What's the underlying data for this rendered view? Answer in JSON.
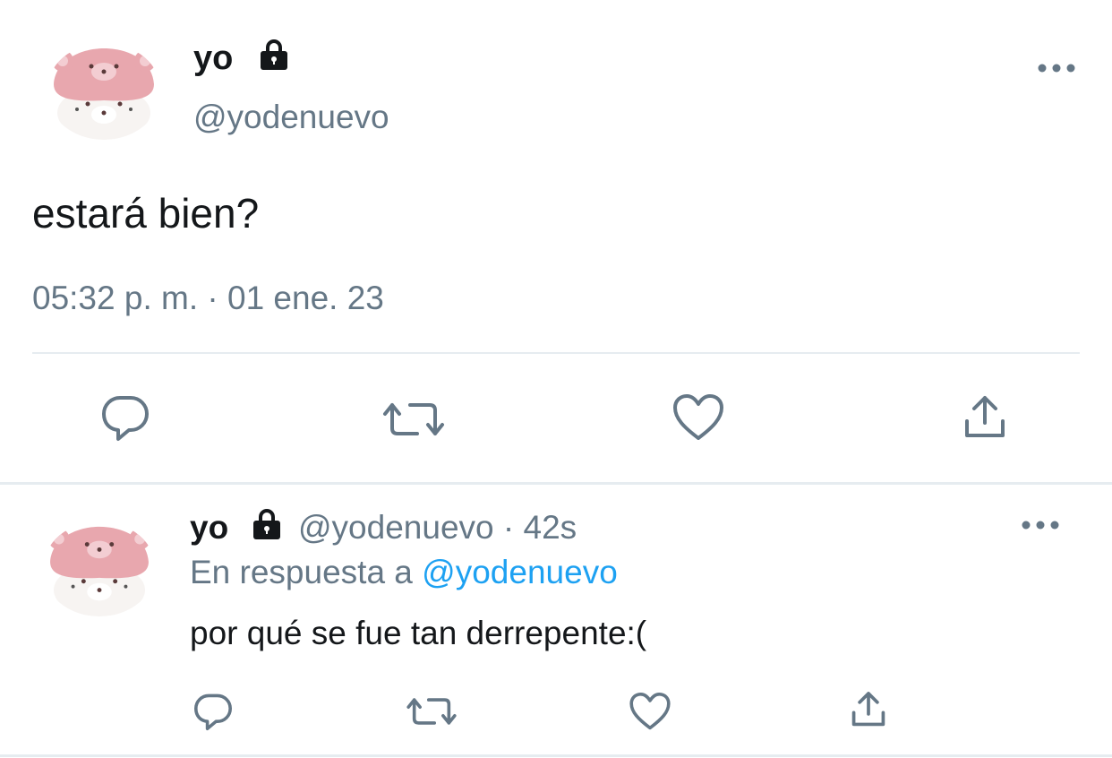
{
  "main_tweet": {
    "name": "yo",
    "handle": "@yodenuevo",
    "text": "estará bien?",
    "timestamp": "05:32 p. m. · 01 ene. 23",
    "avatar_icon": "pink-bear-hat-avatar",
    "protected_icon": "lock-icon",
    "more_icon": "more-dots-icon",
    "actions": [
      "reply-icon",
      "retweet-icon",
      "like-icon",
      "share-icon"
    ]
  },
  "reply_tweet": {
    "name": "yo",
    "handle": "@yodenuevo",
    "separator": "·",
    "age": "42s",
    "in_reply_to_prefix": "En respuesta a",
    "in_reply_to_handle": "@yodenuevo",
    "text": "por qué se fue tan derrepente:(",
    "avatar_icon": "pink-bear-hat-avatar",
    "protected_icon": "lock-icon",
    "more_icon": "more-dots-icon",
    "actions": [
      "reply-icon",
      "retweet-icon",
      "like-icon",
      "share-icon"
    ]
  },
  "colors": {
    "text_primary": "#14171a",
    "text_secondary": "#657786",
    "link": "#1da1f2",
    "icon": "#657786",
    "divider": "#e6ecf0",
    "avatar_hat": "#e8a7ae"
  }
}
